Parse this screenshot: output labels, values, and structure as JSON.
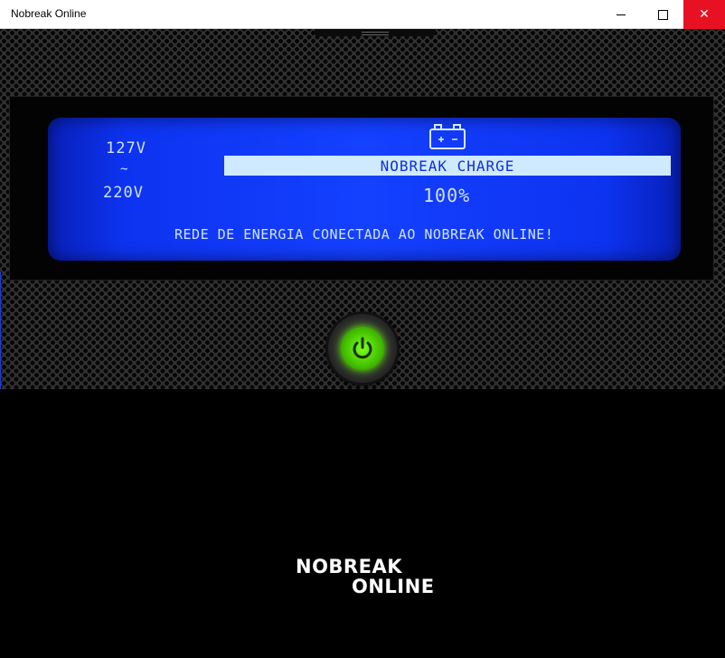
{
  "window": {
    "title": "Nobreak Online",
    "minimize_icon": "minimize-icon",
    "maximize_icon": "maximize-icon",
    "close_glyph": "✕",
    "close_color": "#e81123"
  },
  "lcd": {
    "voltage_low": "127V",
    "voltage_separator": "~",
    "voltage_high": "220V",
    "battery_icon": "battery-icon",
    "charge_label": "NOBREAK CHARGE",
    "charge_percent": "100%",
    "status_message": "REDE DE ENERGIA CONECTADA AO NOBREAK ONLINE!",
    "background_color": "#1440ff",
    "text_color": "#cfe2ff"
  },
  "power_button": {
    "icon": "power-icon",
    "state_color": "#6cff10"
  },
  "logo": {
    "line1": "NOBREAK",
    "line2": "ONLINE"
  }
}
